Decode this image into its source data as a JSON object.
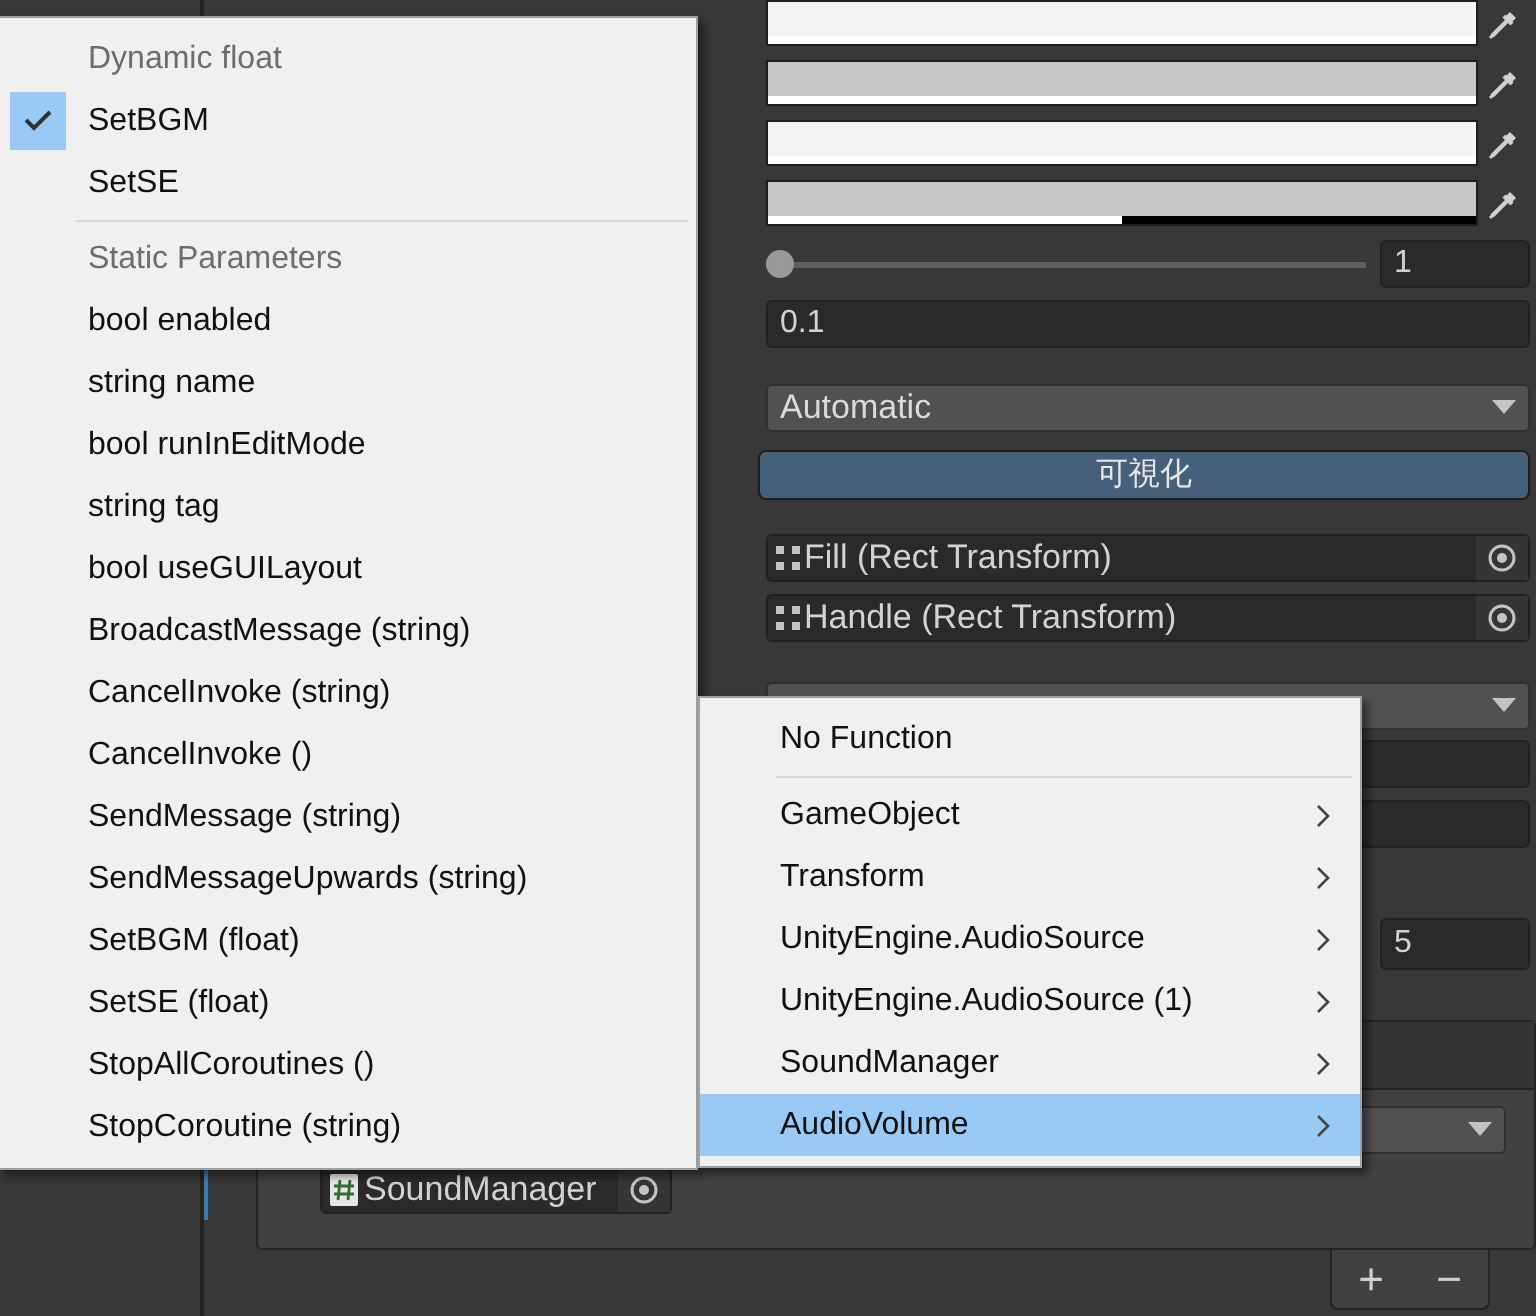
{
  "inspector": {
    "color_fields": [
      {
        "color": "#f4f4f4",
        "level": 1
      },
      {
        "color": "#c8c8c8",
        "level": 1
      },
      {
        "color": "#f4f4f4",
        "level": 1
      },
      {
        "color": "#c8c8c8",
        "level": 0.5
      }
    ],
    "slider": {
      "level": 0,
      "value": "1"
    },
    "number_field": {
      "value": "0.1"
    },
    "mode_dropdown": {
      "value": "Automatic"
    },
    "visualize_button": {
      "label": "可視化"
    },
    "object_fields": [
      {
        "label": "Fill (Rect Transform)"
      },
      {
        "label": "Handle (Rect Transform)"
      }
    ],
    "count_field": {
      "value": "5"
    }
  },
  "event_panel": {
    "object_field": {
      "label": "SoundManager"
    }
  },
  "list_buttons": [
    "+",
    "−"
  ],
  "context_menu": {
    "sections": [
      {
        "header": "Dynamic float",
        "items": [
          {
            "label": "SetBGM",
            "checked": true
          },
          {
            "label": "SetSE",
            "checked": false
          }
        ]
      },
      {
        "header": "Static Parameters",
        "items": [
          {
            "label": "bool enabled",
            "checked": false
          },
          {
            "label": "string name",
            "checked": false
          },
          {
            "label": "bool runInEditMode",
            "checked": false
          },
          {
            "label": "string tag",
            "checked": false
          },
          {
            "label": "bool useGUILayout",
            "checked": false
          },
          {
            "label": "BroadcastMessage (string)",
            "checked": false
          },
          {
            "label": "CancelInvoke (string)",
            "checked": false
          },
          {
            "label": "CancelInvoke ()",
            "checked": false
          },
          {
            "label": "SendMessage (string)",
            "checked": false
          },
          {
            "label": "SendMessageUpwards (string)",
            "checked": false
          },
          {
            "label": "SetBGM (float)",
            "checked": false
          },
          {
            "label": "SetSE (float)",
            "checked": false
          },
          {
            "label": "StopAllCoroutines ()",
            "checked": false
          },
          {
            "label": "StopCoroutine (string)",
            "checked": false
          }
        ]
      }
    ]
  },
  "submenu": {
    "items": [
      {
        "label": "No Function",
        "kind": "action",
        "selected": false
      },
      {
        "label": "GameObject",
        "kind": "submenu",
        "selected": false
      },
      {
        "label": "Transform",
        "kind": "submenu",
        "selected": false
      },
      {
        "label": "UnityEngine.AudioSource",
        "kind": "submenu",
        "selected": false
      },
      {
        "label": "UnityEngine.AudioSource (1)",
        "kind": "submenu",
        "selected": false
      },
      {
        "label": "SoundManager",
        "kind": "submenu",
        "selected": false
      },
      {
        "label": "AudioVolume",
        "kind": "submenu",
        "selected": true
      }
    ]
  }
}
